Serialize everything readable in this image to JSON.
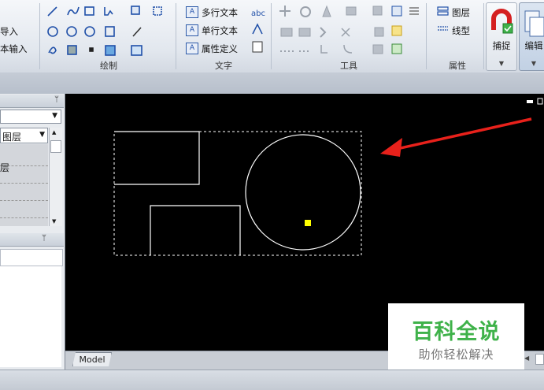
{
  "ribbon": {
    "left_partial": {
      "import_label": "导入",
      "block_insert_label": "本输入"
    },
    "draw_group": {
      "label": "绘制"
    },
    "text_group": {
      "label": "文字",
      "mtext": "多行文本",
      "stext": "单行文本",
      "attdef": "属性定义"
    },
    "tools_group": {
      "label": "工具"
    },
    "props_group": {
      "label": "属性",
      "layer": "图层",
      "linetype": "线型"
    },
    "snap_label": "捕捉",
    "edit_label": "编辑"
  },
  "left_panel": {
    "layer_combo_value": "图层",
    "row_partial": "层",
    "pin1": "ᛘ",
    "pin2": "ᛘ"
  },
  "canvas": {
    "model_tab": "Model"
  },
  "watermark": {
    "title": "百科全说",
    "subtitle": "助你轻松解决"
  },
  "colors": {
    "accent_red": "#e8211b",
    "grip_yellow": "#ffff00",
    "watermark_green": "#3fb24a"
  }
}
